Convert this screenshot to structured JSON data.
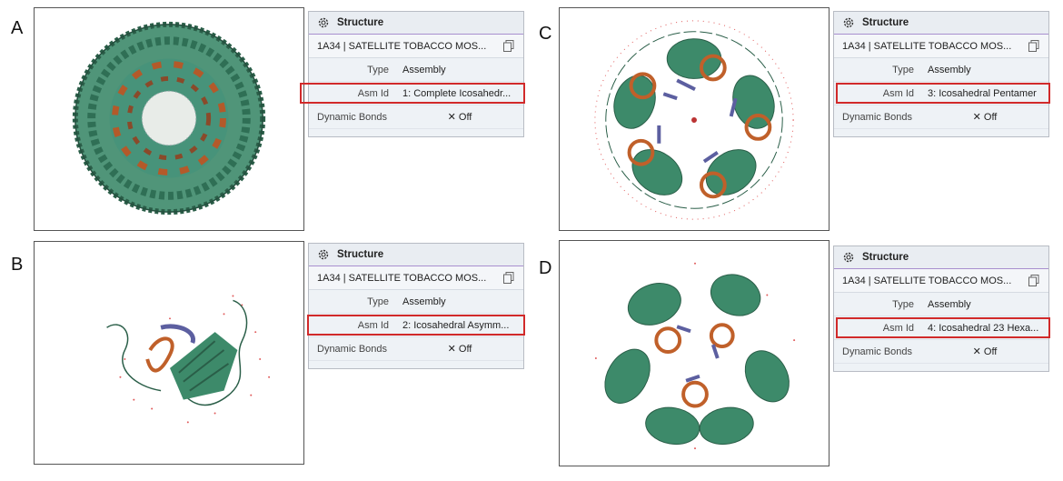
{
  "panels": [
    {
      "letter": "A",
      "structure_label": "Structure",
      "entry_title": "1A34 | SATELLITE TOBACCO MOS...",
      "type_key": "Type",
      "type_value": "Assembly",
      "asm_key": "Asm Id",
      "asm_value": "1: Complete Icosahedr...",
      "bonds_key": "Dynamic Bonds",
      "bonds_value": "✕  Off",
      "icons": {
        "header": "gear-icon",
        "title": "copy-icon"
      }
    },
    {
      "letter": "B",
      "structure_label": "Structure",
      "entry_title": "1A34 | SATELLITE TOBACCO MOS...",
      "type_key": "Type",
      "type_value": "Assembly",
      "asm_key": "Asm Id",
      "asm_value": "2: Icosahedral Asymm...",
      "bonds_key": "Dynamic Bonds",
      "bonds_value": "✕  Off",
      "icons": {
        "header": "gear-icon",
        "title": "copy-icon"
      }
    },
    {
      "letter": "C",
      "structure_label": "Structure",
      "entry_title": "1A34 | SATELLITE TOBACCO MOS...",
      "type_key": "Type",
      "type_value": "Assembly",
      "asm_key": "Asm Id",
      "asm_value": "3: Icosahedral Pentamer",
      "bonds_key": "Dynamic Bonds",
      "bonds_value": "✕  Off",
      "icons": {
        "header": "gear-icon",
        "title": "copy-icon"
      }
    },
    {
      "letter": "D",
      "structure_label": "Structure",
      "entry_title": "1A34 | SATELLITE TOBACCO MOS...",
      "type_key": "Type",
      "type_value": "Assembly",
      "asm_key": "Asm Id",
      "asm_value": "4: Icosahedral 23 Hexa...",
      "bonds_key": "Dynamic Bonds",
      "bonds_value": "✕  Off",
      "icons": {
        "header": "gear-icon",
        "title": "copy-icon"
      }
    }
  ],
  "colors": {
    "protein": "#3d8a6a",
    "rna_orange": "#c0602a",
    "rna_purple": "#5c5fa0",
    "highlight": "#d12a2a",
    "water": "#e05a5a"
  }
}
